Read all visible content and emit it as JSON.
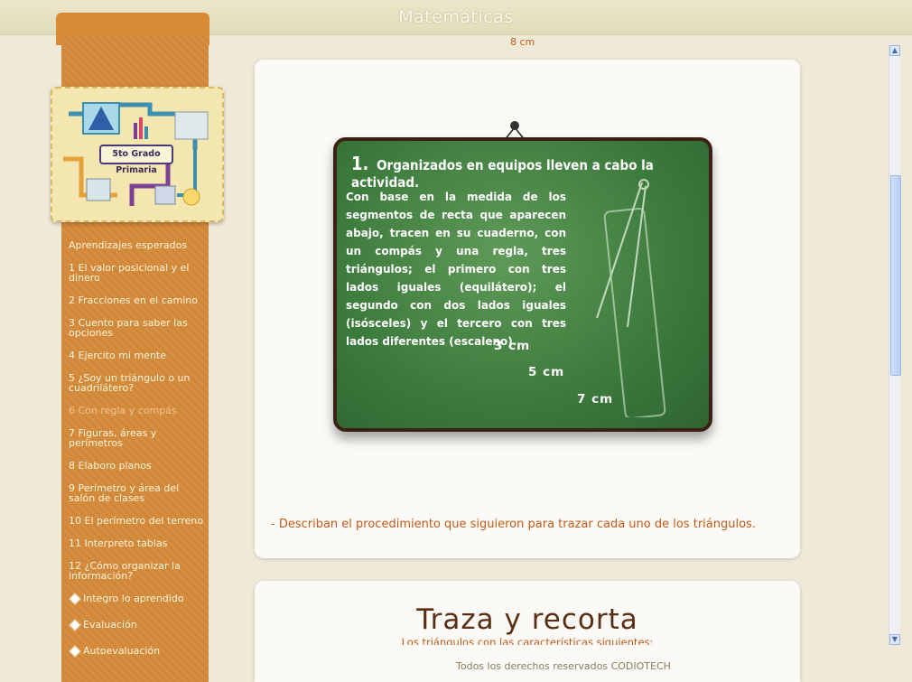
{
  "header": {
    "title": "Matemáticas"
  },
  "sidebar": {
    "grade_label": "5to Grado Primaria",
    "items": [
      {
        "label": "Aprendizajes esperados"
      },
      {
        "label": "1 El valor posicional y el dinero"
      },
      {
        "label": "2 Fracciones en el camino"
      },
      {
        "label": "3 Cuento para saber las opciones"
      },
      {
        "label": "4 Ejercito mi mente"
      },
      {
        "label": "5 ¿Soy un triángulo o un cuadrilátero?"
      },
      {
        "label": "6 Con regla y compás",
        "active": true
      },
      {
        "label": "7 Figuras, áreas y perímetros"
      },
      {
        "label": "8 Elaboro planos"
      },
      {
        "label": "9 Perímetro y área del salón de clases"
      },
      {
        "label": "10 El perímetro del terreno"
      },
      {
        "label": "11 Interpreto tablas"
      },
      {
        "label": "12 ¿Cómo organizar la información?"
      },
      {
        "label": "Integro lo aprendido"
      },
      {
        "label": "Evaluación"
      },
      {
        "label": "Autoevaluación"
      }
    ]
  },
  "main": {
    "peek_text": "8 cm",
    "board": {
      "step_number": "1.",
      "step_title": "Organizados en equipos lleven a cabo la actividad.",
      "body": "Con base en la medida de los segmentos de recta que aparecen abajo, tracen en su cuaderno, con un compás y una regla, tres triángulos; el primero con tres lados iguales (equilátero); el segundo con dos lados iguales (isósceles) y el tercero con tres lados diferentes (escaleno).",
      "measures": [
        "3 cm",
        "5 cm",
        "7 cm"
      ]
    },
    "instruction": "- Describan el procedimiento que siguieron para trazar cada uno de los triángulos.",
    "section2": {
      "title": "Traza y recorta",
      "subtitle": "Los triángulos con las características siguientes:"
    }
  },
  "footer": {
    "text": "Todos los derechos reservados CODIOTECH"
  },
  "colors": {
    "sidebar": "#d48a3a",
    "accent": "#c05a1a",
    "board": "#3c7a3c"
  }
}
